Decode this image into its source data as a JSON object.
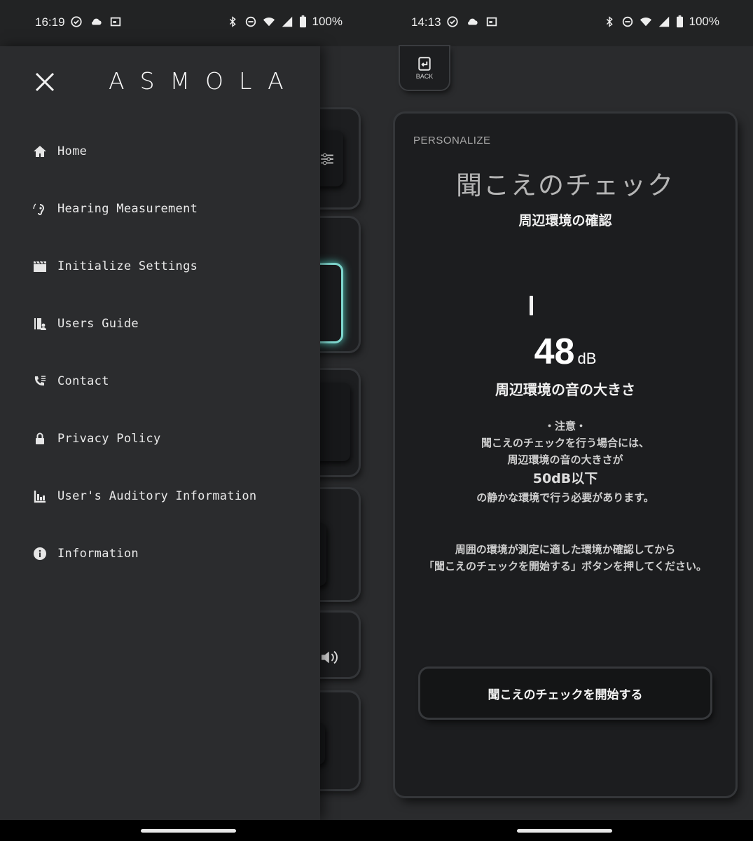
{
  "left": {
    "status": {
      "time": "16:19",
      "battery": "100%"
    },
    "drawer": {
      "logo": "ASMOLA",
      "menu": [
        {
          "label": "Home",
          "icon": "home-icon"
        },
        {
          "label": "Hearing Measurement",
          "icon": "hearing-icon"
        },
        {
          "label": "Initialize Settings",
          "icon": "clapperboard-icon"
        },
        {
          "label": "Users Guide",
          "icon": "guide-book-icon"
        },
        {
          "label": "Contact",
          "icon": "contact-phone-icon"
        },
        {
          "label": "Privacy Policy",
          "icon": "lock-icon"
        },
        {
          "label": "User's Auditory Information",
          "icon": "chart-icon"
        },
        {
          "label": "Information",
          "icon": "info-icon"
        }
      ]
    }
  },
  "right": {
    "status": {
      "time": "14:13",
      "battery": "100%"
    },
    "back_label": "BACK",
    "card": {
      "section": "PERSONALIZE",
      "title": "聞こえのチェック",
      "subtitle": "周辺環境の確認",
      "db_value": "48",
      "db_unit": "dB",
      "db_caption": "周辺環境の音の大きさ",
      "note_head": "・注意・",
      "note_line1": "聞こえのチェックを行う場合には、",
      "note_line2": "周辺環境の音の大きさが",
      "note_threshold": "50dB以下",
      "note_line3": "の静かな環境で行う必要があります。",
      "instr_line1": "周囲の環境が測定に適した環境か確認してから",
      "instr_line2": "「聞こえのチェックを開始する」ボタンを押してください。",
      "start_button": "聞こえのチェックを開始する"
    }
  },
  "colors": {
    "accent_glow": "#7fd8cf",
    "background": "#2a2b2d",
    "card": "#1c1d1f"
  }
}
